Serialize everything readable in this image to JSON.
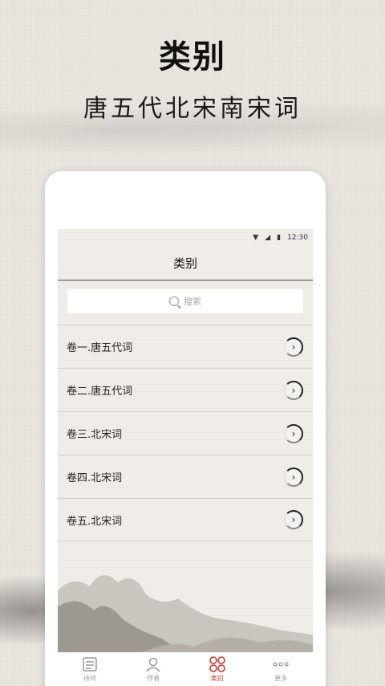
{
  "header": {
    "title": "类别",
    "subtitle": "唐五代北宋南宋词"
  },
  "status_bar": {
    "time": "12:30",
    "wifi_icon": "wifi-icon",
    "signal_icon": "signal-icon",
    "battery_icon": "battery-icon"
  },
  "screen": {
    "title": "类别",
    "search": {
      "placeholder": "搜索",
      "icon": "search-icon"
    },
    "items": [
      {
        "label": "卷一.唐五代词",
        "icon": "chevron-right-icon"
      },
      {
        "label": "卷二.唐五代词",
        "icon": "chevron-right-icon"
      },
      {
        "label": "卷三.北宋词",
        "icon": "chevron-right-icon"
      },
      {
        "label": "卷四.北宋词",
        "icon": "chevron-right-icon"
      },
      {
        "label": "卷五.北宋词",
        "icon": "chevron-right-icon"
      }
    ]
  },
  "tabbar": {
    "active": "类别",
    "accent_color": "#c23a2e",
    "tabs": [
      {
        "label": "诗词",
        "icon": "book-icon"
      },
      {
        "label": "作者",
        "icon": "person-icon"
      },
      {
        "label": "类别",
        "icon": "category-icon"
      },
      {
        "label": "更多",
        "icon": "more-icon"
      }
    ]
  }
}
